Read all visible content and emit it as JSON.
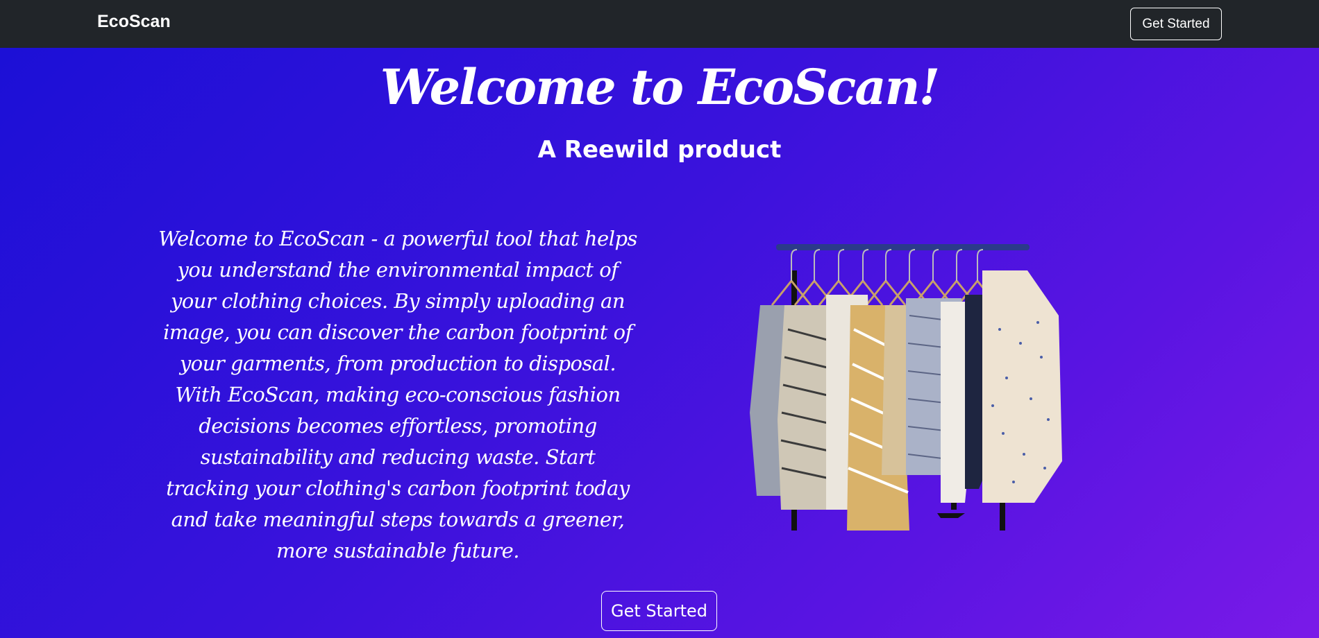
{
  "navbar": {
    "brand": "EcoScan",
    "button_label": "Get Started",
    "background": "#212529"
  },
  "hero": {
    "title": "Welcome to EcoScan!",
    "subtitle": "A Reewild product",
    "description": "Welcome to EcoScan - a powerful tool that helps you understand the environmental impact of your clothing choices. By simply uploading an image, you can discover the carbon footprint of your garments, from production to disposal. With EcoScan, making eco-conscious fashion decisions becomes effortless, promoting sustainability and reducing waste. Start tracking your clothing's carbon footprint today and take meaningful steps towards a greener, more sustainable future.",
    "image_subject": "clothing-rack-image",
    "cta_label": "Get Started"
  },
  "colors": {
    "gradient_start": "#1a10d6",
    "gradient_end": "#7a1ae8",
    "text": "#ffffff"
  }
}
